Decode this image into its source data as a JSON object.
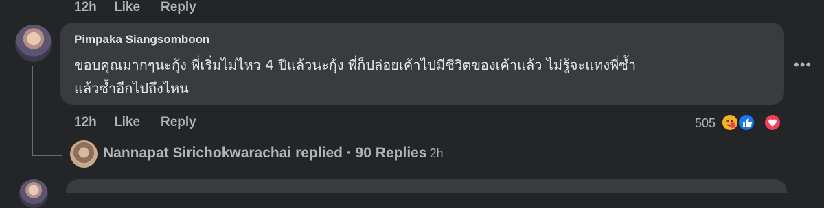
{
  "prev_comment": {
    "time": "12h",
    "like": "Like",
    "reply": "Reply"
  },
  "comment": {
    "author": "Pimpaka Siangsomboon",
    "lines": [
      "ขอบคุณมากๆนะกุ้ง พี่เริ่มไม่ไหว 4 ปีแล้วนะกุ้ง พี่ก็ปล่อยเค้าไปมีชีวิตของเค้าแล้ว ไม่รู้จะแทงพี่ซ้ำ",
      "แล้วซ้ำอีกไปถึงไหน"
    ],
    "more_icon": "ellipsis-icon",
    "time": "12h",
    "like": "Like",
    "reply": "Reply",
    "reaction_count": "505",
    "reactions": [
      "care-reaction-icon",
      "like-reaction-icon",
      "love-reaction-icon"
    ]
  },
  "replies": {
    "text": "Nannapat Sirichokwarachai replied · 90 Replies",
    "time": "2h"
  }
}
